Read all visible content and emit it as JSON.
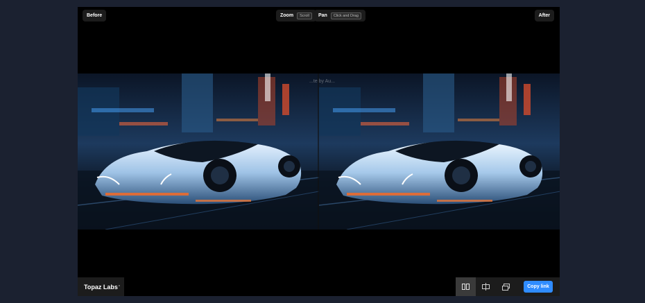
{
  "labels": {
    "before": "Before",
    "after": "After",
    "zoom": "Zoom",
    "zoom_hint": "Scroll",
    "pan": "Pan",
    "pan_hint": "Click and Drag"
  },
  "brand": {
    "name": "Topaz Labs",
    "mark": "°"
  },
  "watermark": "...te by Au...",
  "controls": {
    "copy_link": "Copy link",
    "modes": [
      "side-by-side-icon",
      "split-icon",
      "overlay-icon"
    ],
    "active_mode": "side-by-side-icon"
  },
  "colors": {
    "accent": "#2f8cff",
    "background": "#1b2130"
  }
}
